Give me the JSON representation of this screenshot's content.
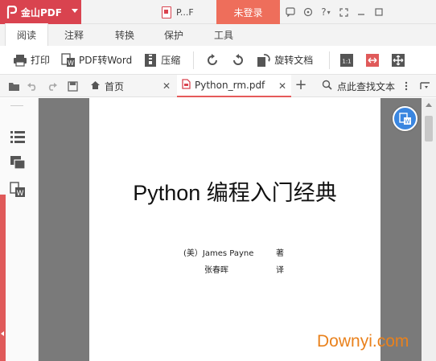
{
  "app": {
    "name": "金山PDF",
    "doc_title_short": "P...F",
    "login_label": "未登录"
  },
  "window_controls": [
    "help-dropdown",
    "question",
    "restore",
    "minimize",
    "close"
  ],
  "window_question_label": "?",
  "ribbon_tabs": [
    "阅读",
    "注释",
    "转换",
    "保护",
    "工具"
  ],
  "toolbar": {
    "print": "打印",
    "pdf_to_word": "PDF转Word",
    "compress": "压缩",
    "rotate_doc": "旋转文档"
  },
  "doc_tabs": {
    "home": "首页",
    "file": "Python_rm.pdf",
    "search_placeholder": "点此查找文本"
  },
  "document": {
    "title": "Python 编程入门经典",
    "author_prefix": "(美）James Payne",
    "author_role": "著",
    "translator": "张春晖",
    "translator_role": "译"
  },
  "watermark": "Downyi.com",
  "colors": {
    "brand_red": "#d9434f",
    "login_orange": "#ee6e5b",
    "float_blue": "#3a86e0",
    "watermark_orange": "#e9811c"
  }
}
